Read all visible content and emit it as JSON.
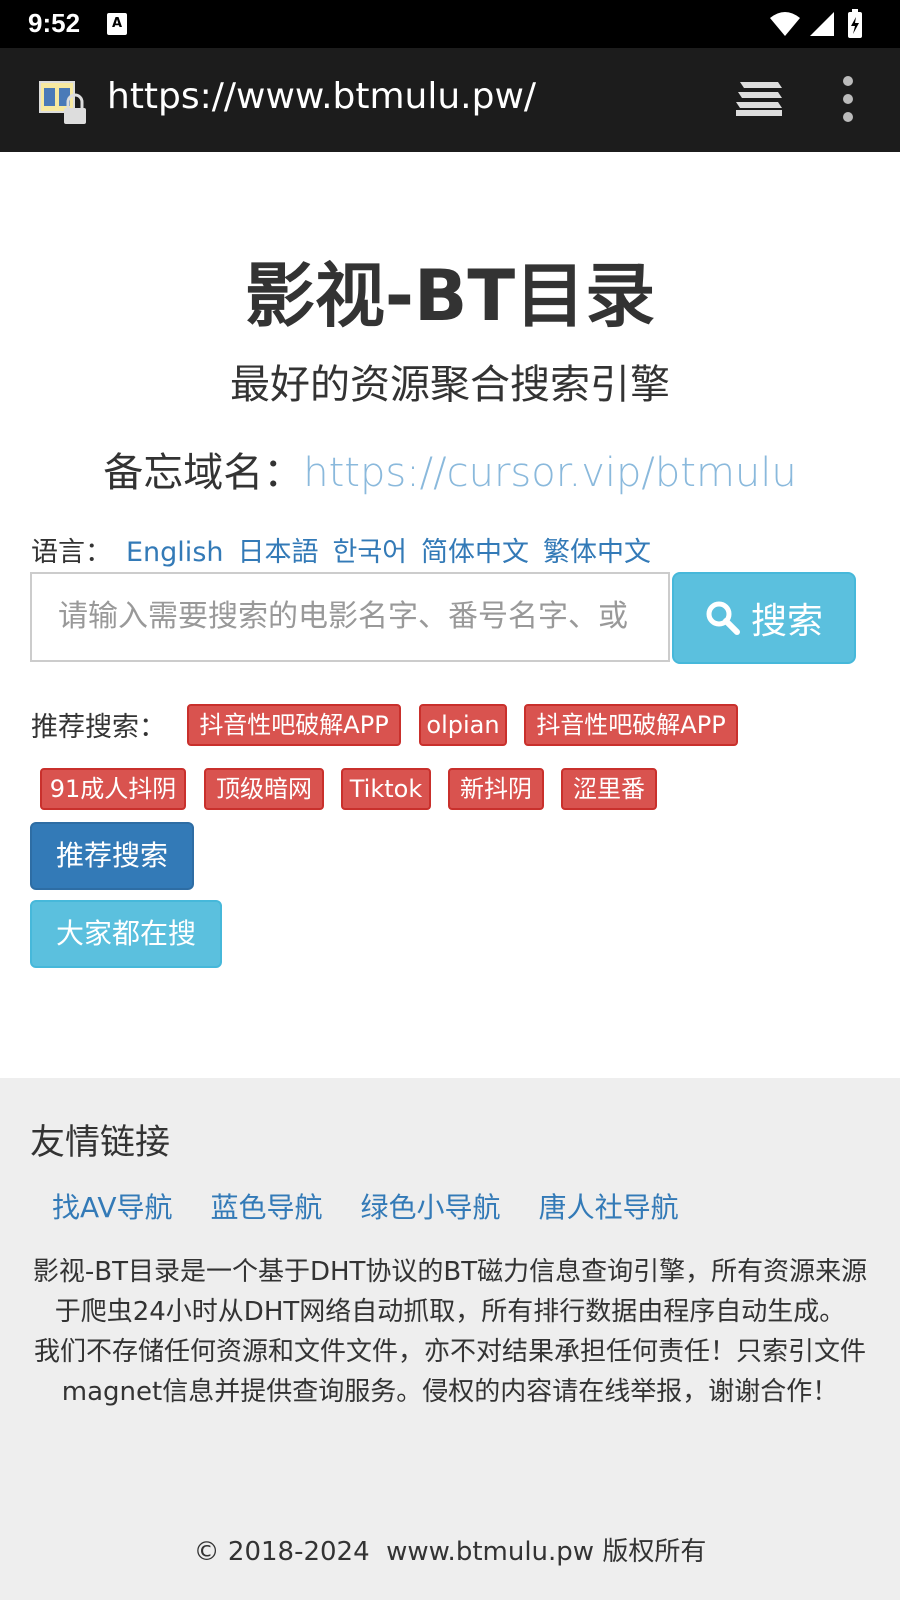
{
  "status_bar": {
    "time": "9:52",
    "a_badge": "A"
  },
  "browser": {
    "url": "https://www.btmulu.pw/"
  },
  "site": {
    "title": "影视-BT目录",
    "subtitle": "最好的资源聚合搜索引擎",
    "mirror_label": "备忘域名：",
    "mirror_link": "https://cursor.vip/btmulu"
  },
  "language": {
    "label": "语言：",
    "options": [
      "English",
      "日本語",
      "한국어",
      "简体中文",
      "繁体中文"
    ]
  },
  "search": {
    "placeholder": "请输入需要搜索的电影名字、番号名字、或",
    "button_label": "搜索"
  },
  "recommend": {
    "label": "推荐搜索：",
    "tags": [
      "抖音性吧破解APP",
      "olpian",
      "抖音性吧破解APP",
      "91成人抖阴",
      "顶级暗网",
      "Tiktok",
      "新抖阴",
      "涩里番"
    ],
    "primary_button": "推荐搜索",
    "info_button": "大家都在搜"
  },
  "footer": {
    "friends_title": "友情链接",
    "friend_links": [
      "找AV导航",
      "蓝色导航",
      "绿色小导航",
      "唐人社导航"
    ],
    "description_1": "影视-BT目录是一个基于DHT协议的BT磁力信息查询引擎，所有资源来源于爬虫24小时从DHT网络自动抓取，所有排行数据由程序自动生成。",
    "description_2": "我们不存储任何资源和文件文件，亦不对结果承担任何责任！只索引文件magnet信息并提供查询服务。侵权的内容请在线举报，谢谢合作！",
    "copyright": "© 2018-2024  www.btmulu.pw 版权所有"
  },
  "colors": {
    "link": "#337ab7",
    "mirror_link": "#8ab9dc",
    "tag_red": "#d9534f",
    "btn_primary": "#337ab7",
    "btn_info": "#5bc0de",
    "footer_bg": "#eeeeee"
  }
}
